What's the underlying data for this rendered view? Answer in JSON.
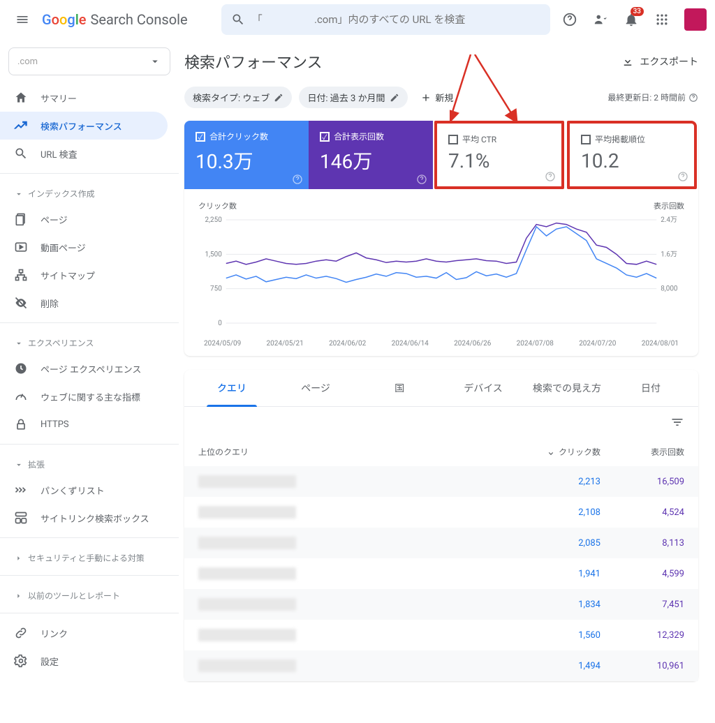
{
  "header": {
    "app_name": "Search Console",
    "search_placeholder": "「                    .com」内のすべての URL を検査",
    "notification_count": "33"
  },
  "property_selector": ".com",
  "sidebar": {
    "items_top": [
      {
        "label": "サマリー"
      },
      {
        "label": "検索パフォーマンス"
      },
      {
        "label": "URL 検査"
      }
    ],
    "section_index": "インデックス作成",
    "items_index": [
      {
        "label": "ページ"
      },
      {
        "label": "動画ページ"
      },
      {
        "label": "サイトマップ"
      },
      {
        "label": "削除"
      }
    ],
    "section_experience": "エクスペリエンス",
    "items_exp": [
      {
        "label": "ページ エクスペリエンス"
      },
      {
        "label": "ウェブに関する主な指標"
      },
      {
        "label": "HTTPS"
      }
    ],
    "section_enhance": "拡張",
    "items_enh": [
      {
        "label": "パンくずリスト"
      },
      {
        "label": "サイトリンク検索ボックス"
      }
    ],
    "section_security": "セキュリティと手動による対策",
    "section_legacy": "以前のツールとレポート",
    "items_bottom": [
      {
        "label": "リンク"
      },
      {
        "label": "設定"
      }
    ]
  },
  "page": {
    "title": "検索パフォーマンス",
    "export": "エクスポート",
    "chip_type": "検索タイプ: ウェブ",
    "chip_date": "日付: 過去 3 か月間",
    "chip_new": "新規",
    "updated": "最終更新日: 2 時間前"
  },
  "metrics": {
    "clicks_label": "合計クリック数",
    "clicks_value": "10.3万",
    "impr_label": "合計表示回数",
    "impr_value": "146万",
    "ctr_label": "平均 CTR",
    "ctr_value": "7.1%",
    "pos_label": "平均掲載順位",
    "pos_value": "10.2"
  },
  "chart_data": {
    "type": "line",
    "left_label": "クリック数",
    "right_label": "表示回数",
    "y_left_ticks": [
      "0",
      "750",
      "1,500",
      "2,250"
    ],
    "y_right_ticks": [
      "",
      "8,000",
      "1.6万",
      "2.4万"
    ],
    "x_ticks": [
      "2024/05/09",
      "2024/05/21",
      "2024/06/02",
      "2024/06/14",
      "2024/06/26",
      "2024/07/08",
      "2024/07/20",
      "2024/08/01"
    ],
    "series": [
      {
        "name": "clicks",
        "color": "#4285f4",
        "values": [
          980,
          1050,
          960,
          1020,
          900,
          950,
          1000,
          970,
          1050,
          980,
          1020,
          970,
          890,
          950,
          1000,
          1070,
          1020,
          1100,
          1080,
          1000,
          1020,
          980,
          1100,
          950,
          990,
          1120,
          1030,
          1070,
          1000,
          1080,
          1600,
          2100,
          1900,
          2050,
          2100,
          1950,
          1800,
          1400,
          1300,
          1200,
          1050,
          1000,
          1080,
          980
        ]
      },
      {
        "name": "impressions",
        "color": "#5e35b1",
        "values": [
          1300,
          1350,
          1280,
          1330,
          1400,
          1350,
          1300,
          1280,
          1300,
          1350,
          1380,
          1350,
          1450,
          1530,
          1420,
          1380,
          1320,
          1350,
          1330,
          1350,
          1400,
          1350,
          1330,
          1360,
          1380,
          1400,
          1360,
          1350,
          1300,
          1330,
          1850,
          2150,
          2100,
          2180,
          2150,
          2050,
          1980,
          1700,
          1650,
          1500,
          1300,
          1280,
          1350,
          1280
        ]
      }
    ]
  },
  "tabs": [
    "クエリ",
    "ページ",
    "国",
    "デバイス",
    "検索での見え方",
    "日付"
  ],
  "table": {
    "header_query": "上位のクエリ",
    "header_clicks": "クリック数",
    "header_impr": "表示回数",
    "rows": [
      {
        "clicks": "2,213",
        "impr": "16,509"
      },
      {
        "clicks": "2,108",
        "impr": "4,524"
      },
      {
        "clicks": "2,085",
        "impr": "8,113"
      },
      {
        "clicks": "1,941",
        "impr": "4,599"
      },
      {
        "clicks": "1,834",
        "impr": "7,451"
      },
      {
        "clicks": "1,560",
        "impr": "12,329"
      },
      {
        "clicks": "1,494",
        "impr": "10,961"
      }
    ]
  }
}
